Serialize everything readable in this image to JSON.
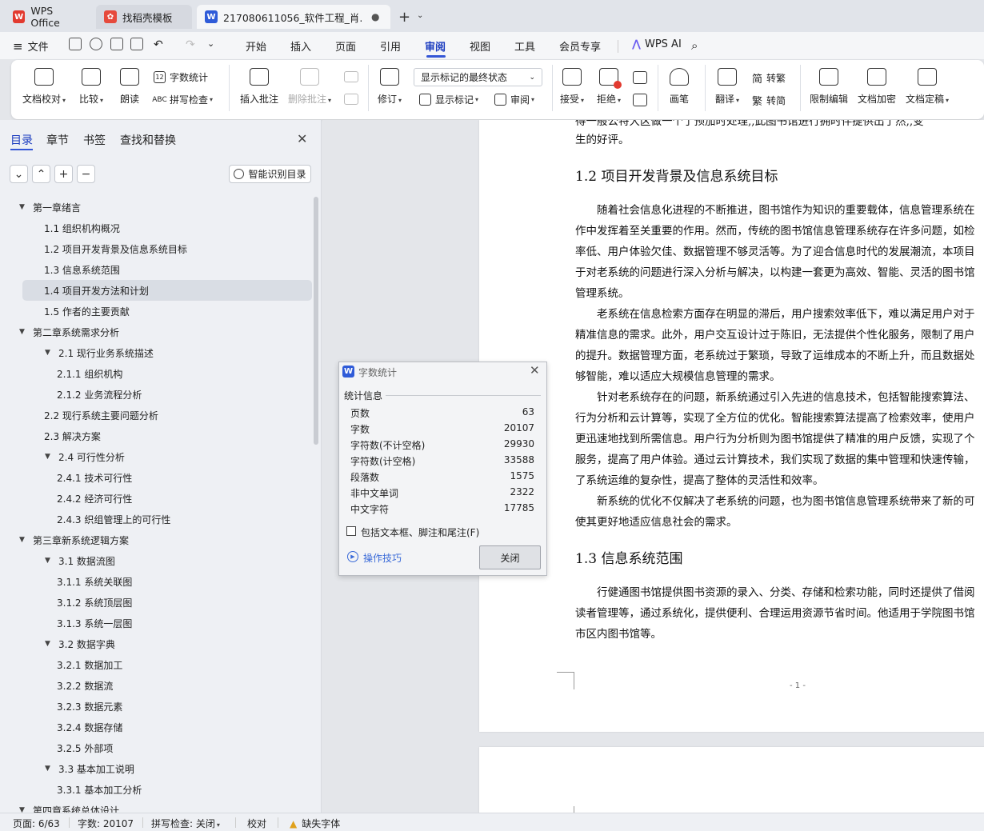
{
  "tabs": [
    {
      "label": "WPS Office",
      "icon": "wps-logo-icon",
      "color": "#e23a2f"
    },
    {
      "label": "找稻壳模板",
      "icon": "daoke-logo-icon",
      "color": "#e64a3c"
    },
    {
      "label": "217080611056_软件工程_肖...",
      "icon": "word-doc-icon",
      "color": "#2f5bd8"
    }
  ],
  "menu": {
    "file": "文件",
    "items": [
      "开始",
      "插入",
      "页面",
      "引用",
      "审阅",
      "视图",
      "工具",
      "会员专享"
    ],
    "active": "审阅",
    "ai": "WPS AI"
  },
  "ribbon": {
    "doc_check": "文档校对",
    "compare": "比较",
    "read_aloud": "朗读",
    "word_count": "字数统计",
    "spell_check": "拼写检查",
    "insert_comment": "插入批注",
    "delete_comment": "删除批注",
    "revise": "修订",
    "markup_dropdown": "显示标记的最终状态",
    "show_markup": "显示标记",
    "review": "审阅",
    "accept": "接受",
    "reject": "拒绝",
    "pen": "画笔",
    "translate": "翻译",
    "to_trad": "转繁",
    "to_simp": "转简",
    "restrict_edit": "限制编辑",
    "encrypt": "文档加密",
    "finalize": "文档定稿"
  },
  "left_panel": {
    "tabs": [
      "目录",
      "章节",
      "书签",
      "查找和替换"
    ],
    "smart_toc": "智能识别目录",
    "toc": [
      {
        "text": "第一章绪言",
        "level": 0,
        "expanded": true
      },
      {
        "text": "1.1 组织机构概况",
        "level": 1
      },
      {
        "text": "1.2 项目开发背景及信息系统目标",
        "level": 1
      },
      {
        "text": "1.3 信息系统范围",
        "level": 1
      },
      {
        "text": "1.4 项目开发方法和计划",
        "level": 1,
        "selected": true
      },
      {
        "text": "1.5 作者的主要贡献",
        "level": 1
      },
      {
        "text": "第二章系统需求分析",
        "level": 0,
        "expanded": true
      },
      {
        "text": "2.1 现行业务系统描述",
        "level": 1,
        "expanded": true
      },
      {
        "text": "2.1.1 组织机构",
        "level": 2
      },
      {
        "text": "2.1.2 业务流程分析",
        "level": 2
      },
      {
        "text": "2.2 现行系统主要问题分析",
        "level": 1
      },
      {
        "text": "2.3 解决方案",
        "level": 1
      },
      {
        "text": "2.4 可行性分析",
        "level": 1,
        "expanded": true
      },
      {
        "text": "2.4.1 技术可行性",
        "level": 2
      },
      {
        "text": "2.4.2 经济可行性",
        "level": 2
      },
      {
        "text": "2.4.3 织组管理上的可行性",
        "level": 2
      },
      {
        "text": "第三章新系统逻辑方案",
        "level": 0,
        "expanded": true
      },
      {
        "text": "3.1 数据流图",
        "level": 1,
        "expanded": true
      },
      {
        "text": "3.1.1 系统关联图",
        "level": 2
      },
      {
        "text": "3.1.2 系统顶层图",
        "level": 2
      },
      {
        "text": "3.1.3 系统一层图",
        "level": 2
      },
      {
        "text": "3.2 数据字典",
        "level": 1,
        "expanded": true
      },
      {
        "text": "3.2.1 数据加工",
        "level": 2
      },
      {
        "text": "3.2.2 数据流",
        "level": 2
      },
      {
        "text": "3.2.3 数据元素",
        "level": 2
      },
      {
        "text": "3.2.4 数据存储",
        "level": 2
      },
      {
        "text": "3.2.5 外部项",
        "level": 2
      },
      {
        "text": "3.3 基本加工说明",
        "level": 1,
        "expanded": true
      },
      {
        "text": "3.3.1 基本加工分析",
        "level": 2
      },
      {
        "text": "第四章系统总体设计",
        "level": 0,
        "expanded": true
      }
    ]
  },
  "document": {
    "lines": [
      {
        "text": "得一般公特大区做一个了预加时处理,,此图书馆进行拥时伴提供出了然,,变",
        "type": "p"
      },
      {
        "text": "生的好评。",
        "type": "p"
      },
      {
        "text": "1.2 项目开发背景及信息系统目标",
        "type": "h"
      },
      {
        "text": "随着社会信息化进程的不断推进，图书馆作为知识的重要载体，信息管理系统在",
        "type": "p",
        "indent": true
      },
      {
        "text": "作中发挥着至关重要的作用。然而，传统的图书馆信息管理系统存在许多问题，如检",
        "type": "p"
      },
      {
        "text": "率低、用户体验欠佳、数据管理不够灵活等。为了迎合信息时代的发展潮流，本项目",
        "type": "p"
      },
      {
        "text": "于对老系统的问题进行深入分析与解决，以构建一套更为高效、智能、灵活的图书馆",
        "type": "p"
      },
      {
        "text": "管理系统。",
        "type": "p"
      },
      {
        "text": "老系统在信息检索方面存在明显的滞后，用户搜索效率低下，难以满足用户对于",
        "type": "p",
        "indent": true
      },
      {
        "text": "精准信息的需求。此外，用户交互设计过于陈旧，无法提供个性化服务，限制了用户",
        "type": "p"
      },
      {
        "text": "的提升。数据管理方面，老系统过于繁琐，导致了运维成本的不断上升，而且数据处",
        "type": "p"
      },
      {
        "text": "够智能，难以适应大规模信息管理的需求。",
        "type": "p"
      },
      {
        "text": "针对老系统存在的问题，新系统通过引入先进的信息技术，包括智能搜索算法、",
        "type": "p",
        "indent": true
      },
      {
        "text": "行为分析和云计算等，实现了全方位的优化。智能搜索算法提高了检索效率，使用户",
        "type": "p"
      },
      {
        "text": "更迅速地找到所需信息。用户行为分析则为图书馆提供了精准的用户反馈，实现了个",
        "type": "p"
      },
      {
        "text": "服务，提高了用户体验。通过云计算技术，我们实现了数据的集中管理和快速传输，",
        "type": "p"
      },
      {
        "text": "了系统运维的复杂性，提高了整体的灵活性和效率。",
        "type": "p"
      },
      {
        "text": "新系统的优化不仅解决了老系统的问题，也为图书馆信息管理系统带来了新的可",
        "type": "p",
        "indent": true
      },
      {
        "text": "使其更好地适应信息社会的需求。",
        "type": "p"
      },
      {
        "text": "1.3 信息系统范围",
        "type": "h"
      },
      {
        "text": "行健通图书馆提供图书资源的录入、分类、存储和检索功能，同时还提供了借阅",
        "type": "p",
        "indent": true
      },
      {
        "text": "读者管理等，通过系统化，提供便利、合理运用资源节省时间。他适用于学院图书馆",
        "type": "p"
      },
      {
        "text": "市区内图书馆等。",
        "type": "p"
      }
    ],
    "page_number": "- 1 -"
  },
  "dialog": {
    "title": "字数统计",
    "section": "统计信息",
    "rows": [
      {
        "label": "页数",
        "value": "63"
      },
      {
        "label": "字数",
        "value": "20107"
      },
      {
        "label": "字符数(不计空格)",
        "value": "29930"
      },
      {
        "label": "字符数(计空格)",
        "value": "33588"
      },
      {
        "label": "段落数",
        "value": "1575"
      },
      {
        "label": "非中文单词",
        "value": "2322"
      },
      {
        "label": "中文字符",
        "value": "17785"
      }
    ],
    "checkbox_label": "包括文本框、脚注和尾注(F)",
    "checkbox_checked": false,
    "tips": "操作技巧",
    "close": "关闭"
  },
  "status": {
    "page": "页面: 6/63",
    "words": "字数: 20107",
    "spell": "拼写检查: 关闭",
    "proof": "校对",
    "missing_font": "缺失字体"
  }
}
